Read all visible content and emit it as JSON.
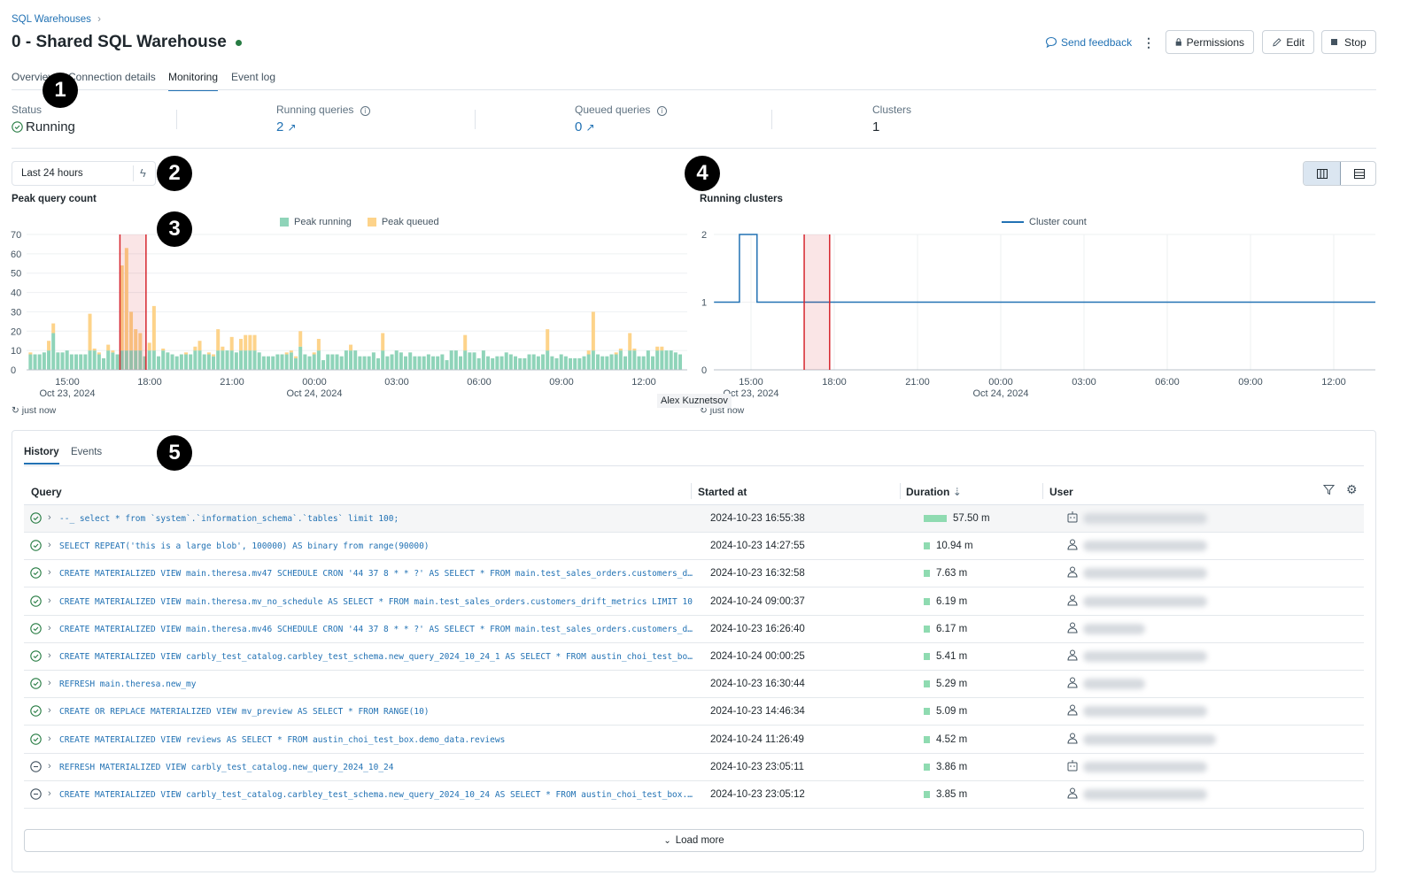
{
  "breadcrumb": {
    "parent": "SQL Warehouses",
    "separator": "›"
  },
  "header": {
    "title": "0 - Shared SQL Warehouse",
    "status_color": "#277c43",
    "send_feedback": "Send feedback",
    "permissions": "Permissions",
    "edit": "Edit",
    "stop": "Stop"
  },
  "tabs": [
    {
      "label": "Overview"
    },
    {
      "label": "Connection details"
    },
    {
      "label": "Monitoring",
      "active": true
    },
    {
      "label": "Event log"
    }
  ],
  "stats": {
    "status_label": "Status",
    "status_value": "Running",
    "running_label": "Running queries",
    "running_value": "2",
    "queued_label": "Queued queries",
    "queued_value": "0",
    "clusters_label": "Clusters",
    "clusters_value": "1"
  },
  "time_range": {
    "value": "Last 24 hours"
  },
  "annotations": [
    "1",
    "2",
    "3",
    "4",
    "5"
  ],
  "tooltip_user": "Alex Kuznetsov",
  "refresh_text": "just now",
  "colors": {
    "running": "#8fd4b9",
    "queued": "#fdd38a",
    "highlight": "#d6262e",
    "link": "#2272b4",
    "line": "#2272b4"
  },
  "chart_data": [
    {
      "type": "bar",
      "stacked": true,
      "title": "Peak query count",
      "interval_minutes": 10,
      "start": "2024-10-23 13:40",
      "ylim": [
        0,
        70
      ],
      "yticks": [
        0,
        10,
        20,
        30,
        40,
        50,
        60,
        70
      ],
      "xticks": [
        {
          "label": "15:00",
          "sub": "Oct 23, 2024"
        },
        {
          "label": "18:00"
        },
        {
          "label": "21:00"
        },
        {
          "label": "00:00",
          "sub": "Oct 24, 2024"
        },
        {
          "label": "03:00"
        },
        {
          "label": "06:00"
        },
        {
          "label": "09:00"
        },
        {
          "label": "12:00"
        }
      ],
      "highlight": [
        "2024-10-23 16:55",
        "2024-10-23 17:52"
      ],
      "legend": "top-center",
      "series": [
        {
          "name": "Peak running",
          "values": [
            8,
            8,
            8,
            9,
            10,
            19,
            9,
            9,
            10,
            8,
            8,
            8,
            8,
            10,
            10,
            8,
            6,
            10,
            9,
            8,
            10,
            10,
            10,
            10,
            10,
            7,
            10,
            10,
            7,
            10,
            9,
            8,
            7,
            8,
            8,
            8,
            10,
            10,
            8,
            8,
            7,
            10,
            10,
            10,
            10,
            9,
            10,
            10,
            10,
            10,
            9,
            7,
            7,
            7,
            8,
            8,
            8,
            9,
            6,
            12,
            8,
            7,
            8,
            10,
            5,
            8,
            8,
            8,
            7,
            10,
            10,
            10,
            7,
            7,
            7,
            9,
            6,
            10,
            7,
            8,
            10,
            9,
            7,
            9,
            7,
            7,
            7,
            8,
            7,
            7,
            8,
            5,
            10,
            10,
            7,
            10,
            9,
            9,
            6,
            10,
            7,
            6,
            7,
            7,
            9,
            8,
            7,
            6,
            6,
            8,
            8,
            7,
            8,
            10,
            7,
            6,
            8,
            7,
            6,
            6,
            6,
            7,
            8,
            10,
            8,
            7,
            7,
            8,
            8,
            10,
            7,
            10,
            10,
            7,
            7,
            10,
            7,
            10,
            10,
            10,
            10,
            9,
            8
          ]
        },
        {
          "name": "Peak queued",
          "values": [
            1,
            0,
            0,
            0,
            5,
            5,
            0,
            0,
            0,
            0,
            0,
            0,
            0,
            19,
            1,
            1,
            0,
            3,
            1,
            0,
            44,
            53,
            20,
            11,
            9,
            0,
            4,
            23,
            0,
            1,
            0,
            0,
            0,
            0,
            1,
            0,
            2,
            5,
            0,
            1,
            1,
            11,
            2,
            0,
            7,
            0,
            6,
            8,
            8,
            8,
            0,
            0,
            0,
            0,
            0,
            0,
            1,
            1,
            1,
            8,
            0,
            0,
            1,
            6,
            0,
            0,
            0,
            0,
            0,
            0,
            3,
            0,
            0,
            0,
            0,
            0,
            0,
            9,
            0,
            0,
            0,
            0,
            0,
            0,
            0,
            0,
            0,
            0,
            0,
            0,
            0,
            0,
            0,
            0,
            0,
            8,
            0,
            0,
            0,
            0,
            0,
            0,
            0,
            0,
            0,
            0,
            0,
            0,
            0,
            0,
            0,
            0,
            0,
            11,
            0,
            0,
            0,
            0,
            0,
            0,
            0,
            0,
            2,
            20,
            0,
            0,
            0,
            0,
            1,
            1,
            0,
            9,
            1,
            0,
            0,
            0,
            0,
            2,
            2,
            0,
            0,
            0,
            0
          ]
        }
      ]
    },
    {
      "type": "line",
      "title": "Running clusters",
      "ylim": [
        0,
        2
      ],
      "yticks": [
        0,
        1,
        2
      ],
      "xticks": [
        {
          "label": "15:00",
          "sub": "Oct 23, 2024"
        },
        {
          "label": "18:00"
        },
        {
          "label": "21:00"
        },
        {
          "label": "00:00",
          "sub": "Oct 24, 2024"
        },
        {
          "label": "03:00"
        },
        {
          "label": "06:00"
        },
        {
          "label": "09:00"
        },
        {
          "label": "12:00"
        }
      ],
      "highlight": [
        "2024-10-23 16:55",
        "2024-10-23 17:50"
      ],
      "legend": "top-center",
      "series": [
        {
          "name": "Cluster count",
          "points": [
            [
              "2024-10-23 13:40",
              1
            ],
            [
              "2024-10-23 14:35",
              1
            ],
            [
              "2024-10-23 14:35",
              2
            ],
            [
              "2024-10-23 15:13",
              2
            ],
            [
              "2024-10-23 15:13",
              1
            ],
            [
              "2024-10-24 13:30",
              1
            ]
          ]
        }
      ]
    }
  ],
  "history": {
    "tabs": [
      "History",
      "Events"
    ],
    "columns": {
      "query": "Query",
      "started": "Started at",
      "duration": "Duration",
      "user": "User"
    },
    "load_more": "Load more",
    "rows": [
      {
        "status": "success",
        "query": "--_  select * from `system`.`information_schema`.`tables` limit 100;",
        "started": "2024-10-23 16:55:38",
        "duration": "57.50 m",
        "minutes": 57.5,
        "user_type": "service"
      },
      {
        "status": "success",
        "query": "SELECT REPEAT('this is a large blob', 100000) AS binary from range(90000)",
        "started": "2024-10-23 14:27:55",
        "duration": "10.94 m",
        "minutes": 10.94,
        "user_type": "person"
      },
      {
        "status": "success",
        "query": "CREATE MATERIALIZED VIEW main.theresa.mv47 SCHEDULE CRON '44 37 8 * * ?' AS SELECT * FROM main.test_sales_orders.customers_dri…",
        "started": "2024-10-23 16:32:58",
        "duration": "7.63 m",
        "minutes": 7.63,
        "user_type": "person"
      },
      {
        "status": "success",
        "query": "CREATE MATERIALIZED VIEW main.theresa.mv_no_schedule AS SELECT * FROM main.test_sales_orders.customers_drift_metrics LIMIT 10",
        "started": "2024-10-24 09:00:37",
        "duration": "6.19 m",
        "minutes": 6.19,
        "user_type": "person"
      },
      {
        "status": "success",
        "query": "CREATE MATERIALIZED VIEW main.theresa.mv46 SCHEDULE CRON '44 37 8 * * ?' AS SELECT * FROM main.test_sales_orders.customers_dri…",
        "started": "2024-10-23 16:26:40",
        "duration": "6.17 m",
        "minutes": 6.17,
        "user_type": "person"
      },
      {
        "status": "success",
        "query": "CREATE MATERIALIZED VIEW carbly_test_catalog.carbley_test_schema.new_query_2024_10_24_1 AS SELECT * FROM austin_choi_test_box.…",
        "started": "2024-10-24 00:00:25",
        "duration": "5.41 m",
        "minutes": 5.41,
        "user_type": "person"
      },
      {
        "status": "success",
        "query": "REFRESH main.theresa.new_my",
        "started": "2024-10-23 16:30:44",
        "duration": "5.29 m",
        "minutes": 5.29,
        "user_type": "person"
      },
      {
        "status": "success",
        "query": "CREATE OR REPLACE MATERIALIZED VIEW mv_preview AS SELECT * FROM RANGE(10)",
        "started": "2024-10-23 14:46:34",
        "duration": "5.09 m",
        "minutes": 5.09,
        "user_type": "person"
      },
      {
        "status": "success",
        "query": "CREATE MATERIALIZED VIEW reviews AS SELECT * FROM austin_choi_test_box.demo_data.reviews",
        "started": "2024-10-24 11:26:49",
        "duration": "4.52 m",
        "minutes": 4.52,
        "user_type": "person"
      },
      {
        "status": "canceled",
        "query": "REFRESH MATERIALIZED VIEW carbly_test_catalog.new_query_2024_10_24",
        "started": "2024-10-23 23:05:11",
        "duration": "3.86 m",
        "minutes": 3.86,
        "user_type": "service"
      },
      {
        "status": "canceled",
        "query": "CREATE MATERIALIZED VIEW carbly_test_catalog.carbley_test_schema.new_query_2024_10_24 AS SELECT * FROM austin_choi_test_box.de…",
        "started": "2024-10-23 23:05:12",
        "duration": "3.85 m",
        "minutes": 3.85,
        "user_type": "person"
      }
    ]
  }
}
